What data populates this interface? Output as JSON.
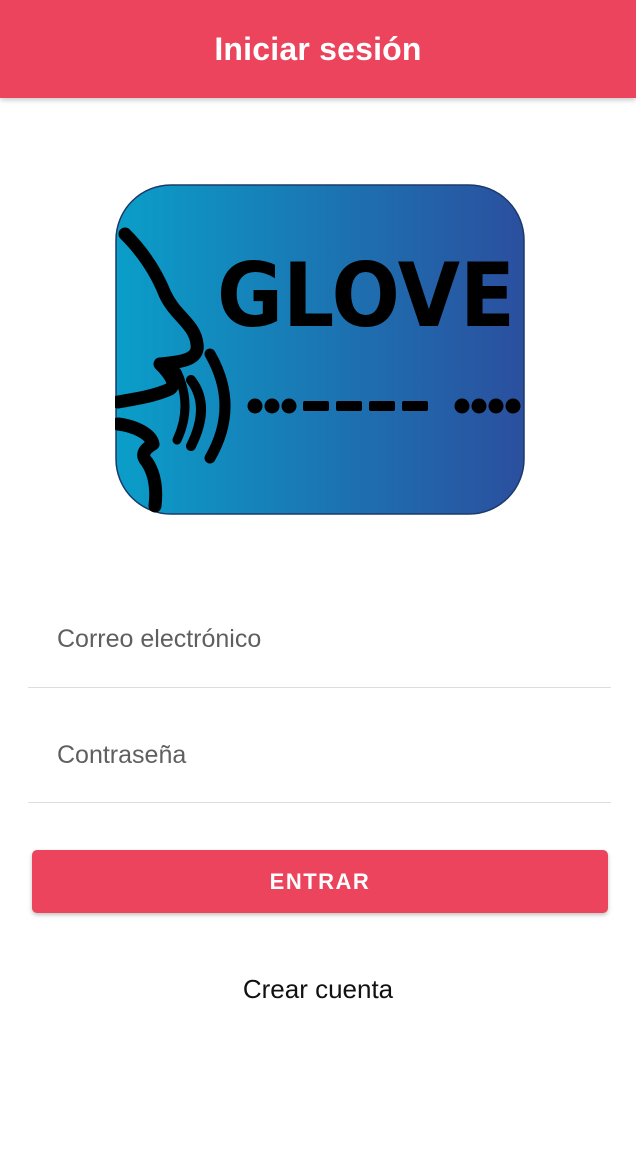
{
  "header": {
    "title": "Iniciar sesión",
    "color": "#eb445c"
  },
  "logo": {
    "text": "GLOVE",
    "gradient": [
      "#0a9ec9",
      "#2b4f9e"
    ]
  },
  "form": {
    "email": {
      "value": "",
      "placeholder": "Correo electrónico"
    },
    "password": {
      "value": "",
      "placeholder": "Contraseña"
    }
  },
  "buttons": {
    "enter_label": "ENTRAR",
    "create_account_label": "Crear cuenta"
  }
}
